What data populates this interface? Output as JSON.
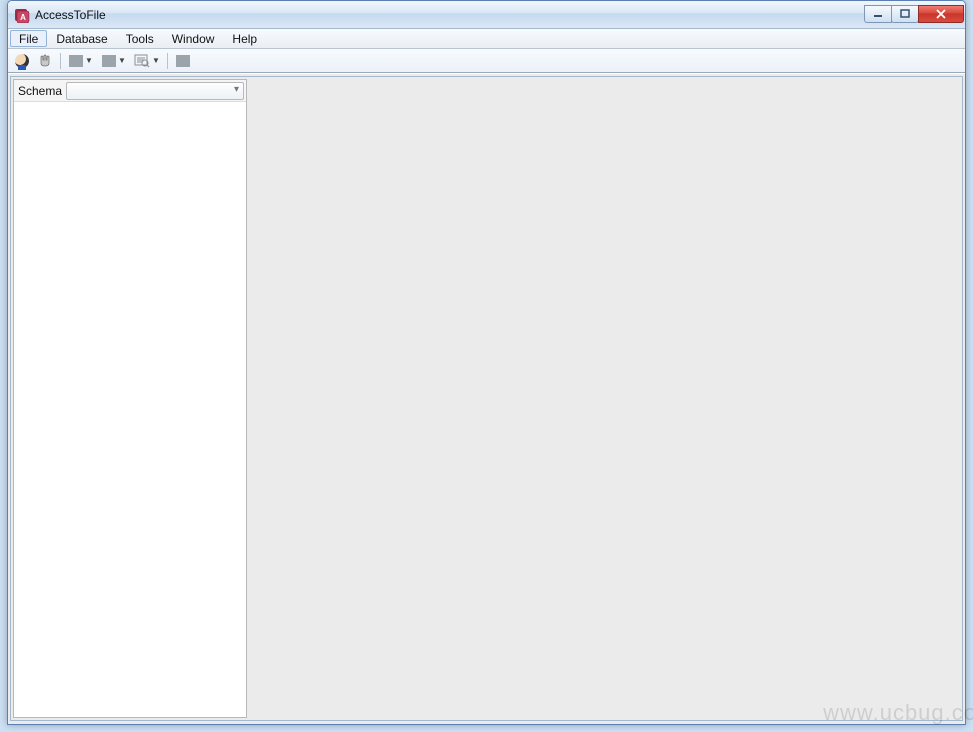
{
  "window": {
    "title": "AccessToFile"
  },
  "menubar": {
    "items": [
      {
        "label": "File"
      },
      {
        "label": "Database"
      },
      {
        "label": "Tools"
      },
      {
        "label": "Window"
      },
      {
        "label": "Help"
      }
    ]
  },
  "sidebar": {
    "schema_label": "Schema",
    "schema_value": ""
  },
  "toolbar": {
    "icons": {
      "user": "user-icon",
      "hand": "hand-icon",
      "import": "import-icon",
      "export": "export-icon",
      "query": "query-icon",
      "stop": "stop-icon"
    }
  },
  "watermark": "www.ucbug.co"
}
